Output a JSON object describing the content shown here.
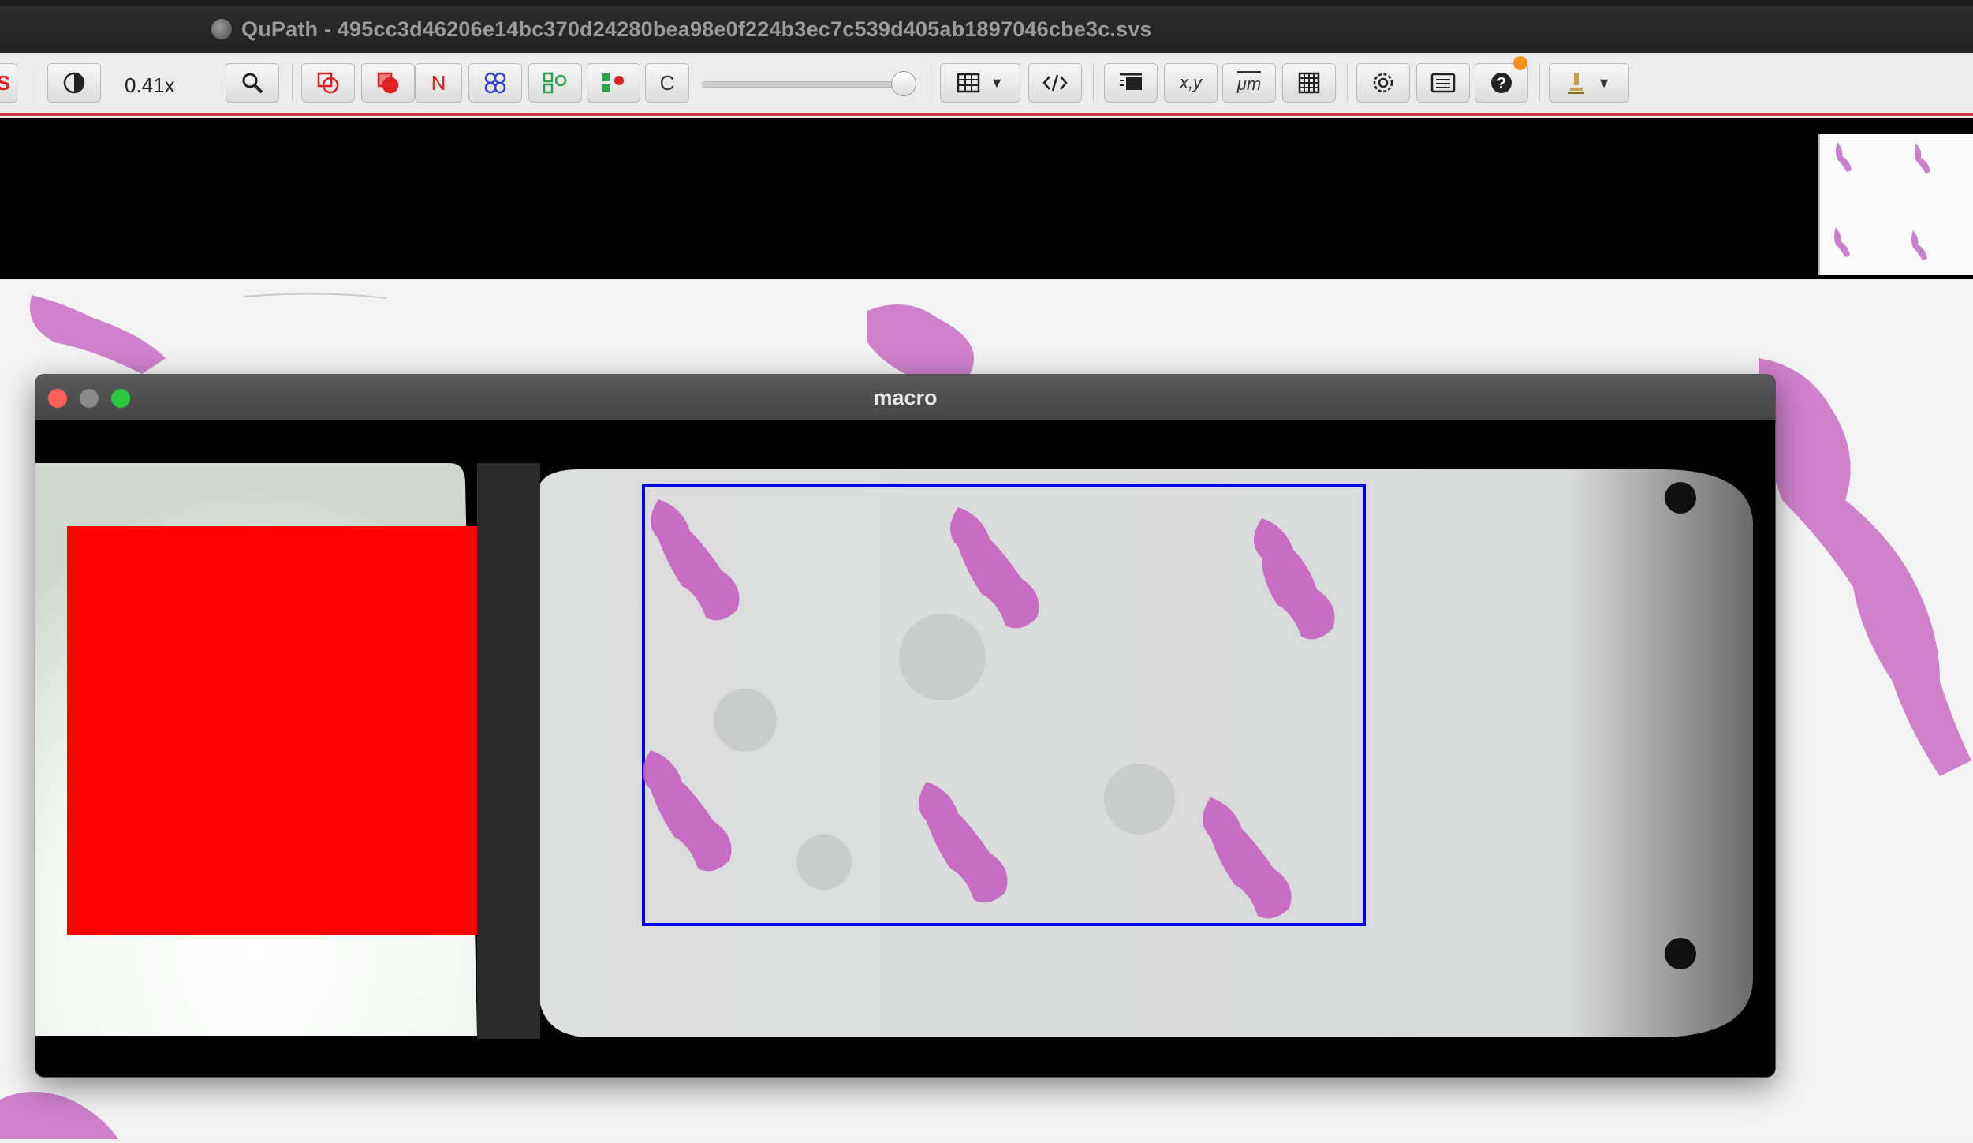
{
  "window": {
    "title": "QuPath - 495cc3d46206e14bc370d24280bea98e0f224b3ec7c539d405ab1897046cbe3c.svs",
    "app_icon": "qupath-icon"
  },
  "toolbar": {
    "zoom_label": "0.41x",
    "cut_letter": "S",
    "rectangle_letter": "N",
    "count_letter": "C",
    "coords_label": "x,y",
    "units_label": "μm",
    "opacity_slider_value": 1.0,
    "icons": [
      "brightness-contrast-icon",
      "zoom-to-fit-icon",
      "show-annotations-icon",
      "fill-annotations-icon",
      "show-names-icon",
      "show-tma-grid-icon",
      "show-detections-icon",
      "fill-detections-icon",
      "show-connections-icon",
      "measurement-table-icon",
      "script-editor-icon",
      "show-overview-icon",
      "show-location-icon",
      "show-scalebar-icon",
      "show-grid-icon",
      "preferences-icon",
      "log-icon",
      "help-icon",
      "microscope-icon"
    ],
    "accent_color": "#c9363a",
    "notification_color": "#f4901e"
  },
  "macro_window": {
    "title": "macro",
    "redaction_color": "#ff0000",
    "scan_region_color": "#0000ee",
    "stain_color": "#c35bbf"
  }
}
